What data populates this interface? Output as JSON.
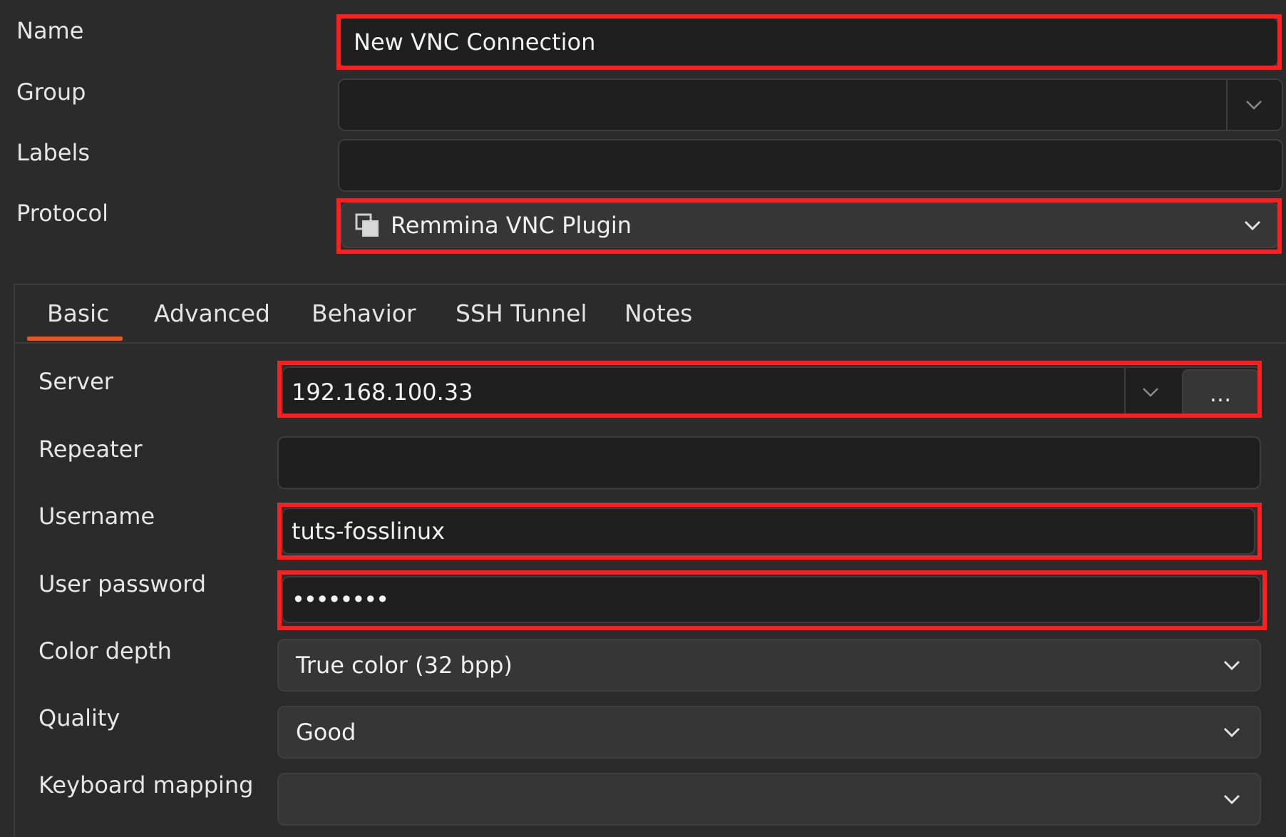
{
  "form": {
    "name_label": "Name",
    "name_value": "New VNC Connection",
    "group_label": "Group",
    "group_value": "",
    "labels_label": "Labels",
    "labels_value": "",
    "protocol_label": "Protocol",
    "protocol_value": "Remmina VNC Plugin"
  },
  "tabs": [
    {
      "label": "Basic",
      "active": true
    },
    {
      "label": "Advanced"
    },
    {
      "label": "Behavior"
    },
    {
      "label": "SSH Tunnel"
    },
    {
      "label": "Notes"
    }
  ],
  "basic": {
    "server_label": "Server",
    "server_value": "192.168.100.33",
    "server_browse_label": "...",
    "repeater_label": "Repeater",
    "repeater_value": "",
    "username_label": "Username",
    "username_value": "tuts-fosslinux",
    "password_label": "User password",
    "password_value": "••••••••",
    "color_depth_label": "Color depth",
    "color_depth_value": "True color (32 bpp)",
    "quality_label": "Quality",
    "quality_value": "Good",
    "keyboard_label": "Keyboard mapping",
    "keyboard_value": ""
  },
  "colors": {
    "highlight": "#ff1f1f",
    "tab_underline": "#e9541f",
    "background": "#2b2b2b"
  }
}
